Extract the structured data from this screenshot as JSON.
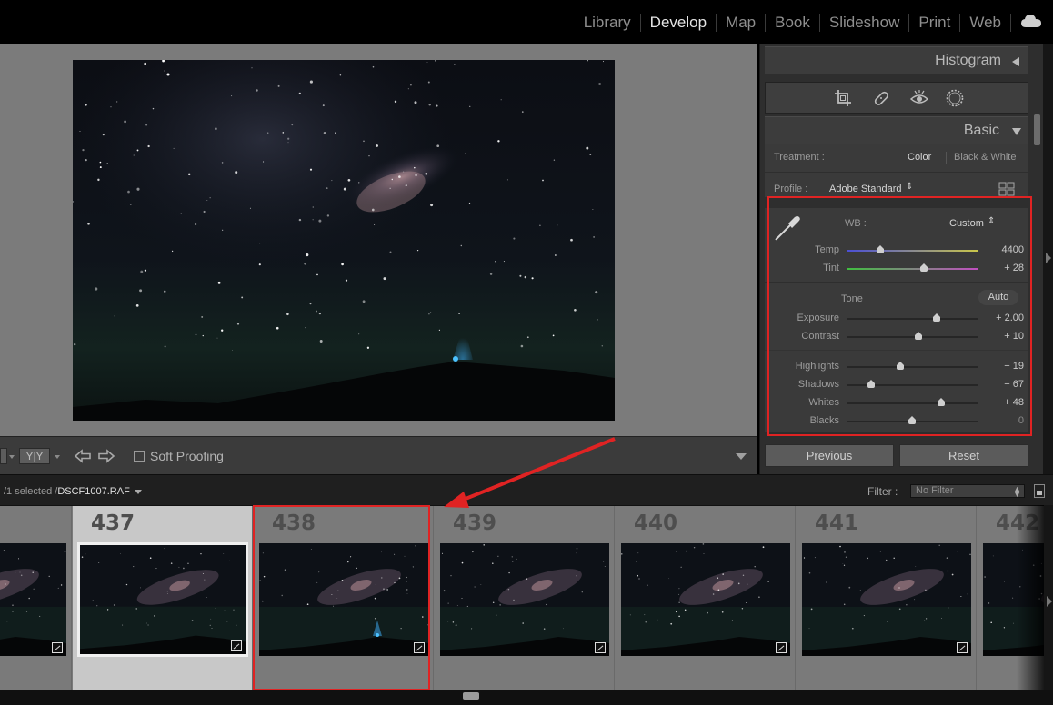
{
  "modules": [
    "Library",
    "Develop",
    "Map",
    "Book",
    "Slideshow",
    "Print",
    "Web"
  ],
  "active_module": "Develop",
  "toolbar": {
    "yy_label": "Y|Y",
    "soft_proofing_label": "Soft Proofing",
    "soft_proofing_checked": false
  },
  "panel": {
    "histogram_title": "Histogram",
    "basic_title": "Basic",
    "treatment_label": "Treatment :",
    "treatment_color": "Color",
    "treatment_bw": "Black & White",
    "profile_label": "Profile :",
    "profile_value": "Adobe Standard",
    "wb_label": "WB :",
    "wb_value": "Custom",
    "temp_label": "Temp",
    "temp_value": "4400",
    "tint_label": "Tint",
    "tint_value": "+ 28",
    "tone_label": "Tone",
    "auto_label": "Auto",
    "exposure_label": "Exposure",
    "exposure_value": "+ 2.00",
    "contrast_label": "Contrast",
    "contrast_value": "+ 10",
    "highlights_label": "Highlights",
    "highlights_value": "− 19",
    "shadows_label": "Shadows",
    "shadows_value": "− 67",
    "whites_label": "Whites",
    "whites_value": "+ 48",
    "blacks_label": "Blacks",
    "blacks_value": "0",
    "previous_label": "Previous",
    "reset_label": "Reset"
  },
  "sliders": {
    "temp": 0.26,
    "tint": 0.59,
    "exposure": 0.69,
    "contrast": 0.55,
    "highlights": 0.41,
    "shadows": 0.19,
    "whites": 0.72,
    "blacks": 0.5
  },
  "filmstrip_header": {
    "selected_info": "/1 selected /",
    "filename": "DSCF1007.RAF",
    "filter_label": "Filter :",
    "filter_value": "No Filter"
  },
  "filmstrip": {
    "cells": [
      "437",
      "438",
      "439",
      "440",
      "441",
      "442"
    ],
    "selected": "437"
  },
  "colors": {
    "highlight_box": "#e02323",
    "background": "#000000"
  }
}
